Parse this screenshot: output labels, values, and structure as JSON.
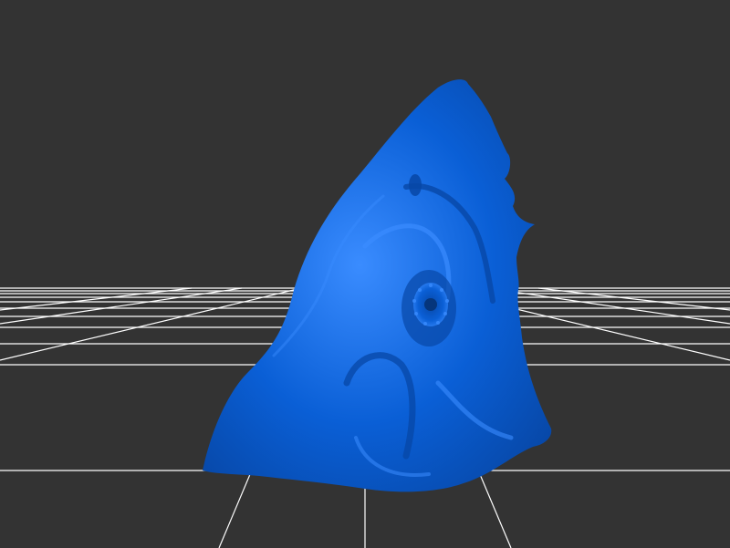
{
  "viewport": {
    "background_color": "#333333",
    "grid_color": "#ffffff",
    "mesh_color": "#0a5fd6",
    "mesh_highlight_color": "#3a8cff",
    "mesh_shadow_color": "#0747a6",
    "icon": "3d-mesh-model"
  }
}
